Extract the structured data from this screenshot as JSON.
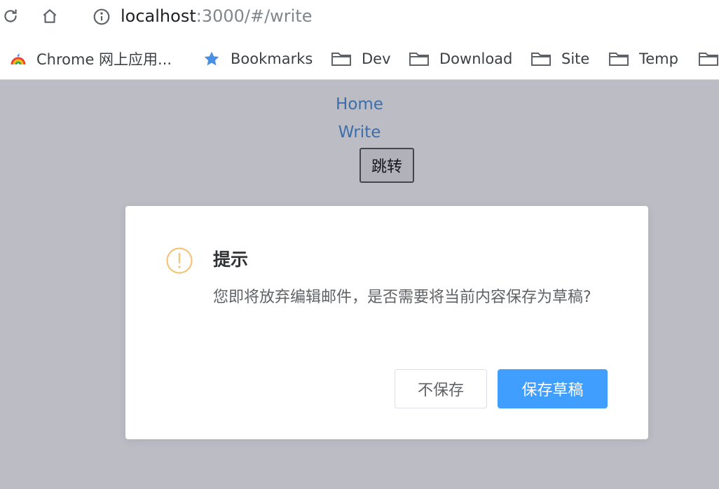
{
  "browser": {
    "url_host": "localhost",
    "url_path": ":3000/#/write",
    "bookmarks": [
      {
        "label": "Chrome 网上应用...",
        "icon": "chrome-apps-icon"
      },
      {
        "label": "Bookmarks",
        "icon": "star-icon"
      },
      {
        "label": "Dev",
        "icon": "folder-icon"
      },
      {
        "label": "Download",
        "icon": "folder-icon"
      },
      {
        "label": "Site",
        "icon": "folder-icon"
      },
      {
        "label": "Temp",
        "icon": "folder-icon"
      }
    ]
  },
  "page": {
    "home_link": "Home",
    "write_link": "Write",
    "jump_button": "跳转"
  },
  "dialog": {
    "title": "提示",
    "message": "您即将放弃编辑邮件，是否需要将当前内容保存为草稿?",
    "cancel_label": "不保存",
    "confirm_label": "保存草稿"
  },
  "colors": {
    "primary": "#409eff",
    "warning": "#e6a23c",
    "link": "#4a90d9"
  }
}
